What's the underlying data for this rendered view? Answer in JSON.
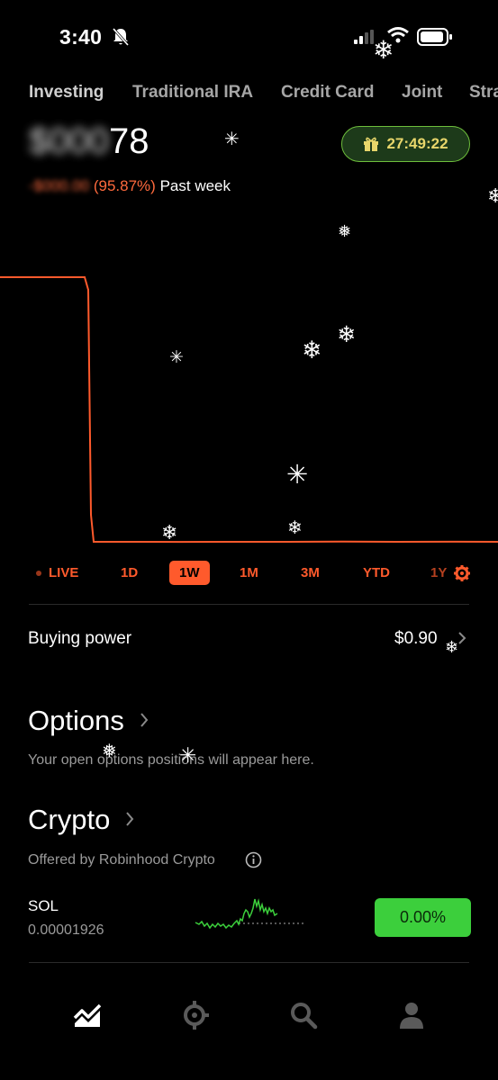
{
  "status_bar": {
    "time": "3:40"
  },
  "tabs": [
    {
      "label": "Investing",
      "active": true
    },
    {
      "label": "Traditional IRA",
      "active": false
    },
    {
      "label": "Credit Card",
      "active": false
    },
    {
      "label": "Joint",
      "active": false
    },
    {
      "label": "Stra",
      "active": false
    }
  ],
  "balance": {
    "hidden_part": "$000",
    "visible_part": "78"
  },
  "change": {
    "amount_hidden": "-$000.00",
    "percent": "(95.87%)",
    "period": "Past week"
  },
  "gift": {
    "timer": "27:49:22",
    "icon": "gift-icon"
  },
  "chart_data": {
    "type": "line",
    "x": [
      0,
      1,
      2,
      3,
      4,
      5,
      6,
      7,
      8,
      9,
      10,
      11,
      12
    ],
    "y": [
      100,
      100,
      100,
      100,
      4.13,
      4.13,
      4.1,
      4.15,
      4.13,
      4.2,
      4.13,
      4.18,
      4.13
    ],
    "color": "#ff5a2c",
    "grid": false,
    "title": "",
    "xlabel": "",
    "ylabel": ""
  },
  "ranges": [
    {
      "label": "LIVE",
      "active": false
    },
    {
      "label": "1D",
      "active": false
    },
    {
      "label": "1W",
      "active": true
    },
    {
      "label": "1M",
      "active": false
    },
    {
      "label": "3M",
      "active": false
    },
    {
      "label": "YTD",
      "active": false
    },
    {
      "label": "1Y",
      "active": false
    }
  ],
  "buying_power": {
    "label": "Buying power",
    "value": "$0.90"
  },
  "options": {
    "title": "Options",
    "subtitle": "Your open options positions will appear here."
  },
  "crypto": {
    "title": "Crypto",
    "subtitle": "Offered by Robinhood Crypto",
    "items": [
      {
        "symbol": "SOL",
        "quantity": "0.00001926",
        "change": "0.00%"
      }
    ]
  },
  "nav": [
    {
      "icon": "chart-icon",
      "active": true
    },
    {
      "icon": "crypto-icon",
      "active": false
    },
    {
      "icon": "search-icon",
      "active": false
    },
    {
      "icon": "account-icon",
      "active": false
    }
  ],
  "colors": {
    "accent": "#ff5a2c",
    "positive": "#3ccf3c",
    "gift_border": "#6ebf3c",
    "gift_text": "#e8d66b"
  }
}
